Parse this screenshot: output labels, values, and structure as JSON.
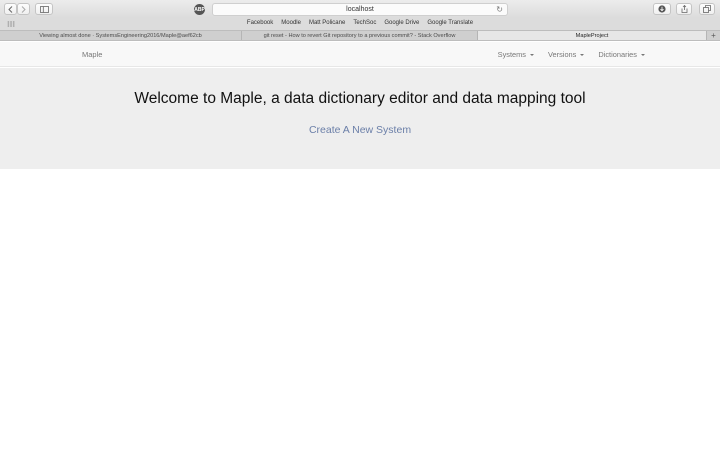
{
  "browser": {
    "address": "localhost",
    "ext_label": "ABP",
    "favorites": [
      "Facebook",
      "Moodle",
      "Matt Policane",
      "TechSoc",
      "Google Drive",
      "Google Translate"
    ],
    "tabs": [
      {
        "label": "Viewing almost done · SystemsEngineering2016/Maple@aef62cb",
        "active": false
      },
      {
        "label": "git reset - How to revert Git repository to a previous commit? - Stack Overflow",
        "active": false
      },
      {
        "label": "MapleProject",
        "active": true
      }
    ],
    "new_tab_glyph": "+"
  },
  "navbar": {
    "brand": "Maple",
    "menus": [
      "Systems",
      "Versions",
      "Dictionaries"
    ]
  },
  "hero": {
    "title": "Welcome to Maple, a data dictionary editor and data mapping tool",
    "link": "Create A New System"
  }
}
